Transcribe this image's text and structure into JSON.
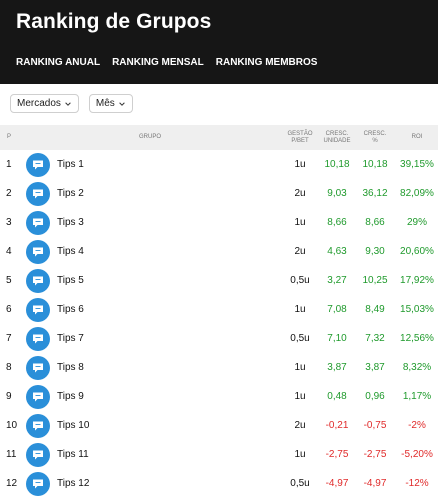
{
  "header": {
    "title": "Ranking de Grupos",
    "nav": [
      "RANKING ANUAL",
      "RANKING MENSAL",
      "RANKING MEMBROS"
    ]
  },
  "filters": {
    "markets_label": "Mercados",
    "period_label": "Mês"
  },
  "table": {
    "columns": {
      "pos": "P",
      "group": "GRUPO",
      "stake": [
        "GESTÃO",
        "P/BET"
      ],
      "units": [
        "CRESC.",
        "UNIDADE"
      ],
      "pct": [
        "CRESC.",
        "%"
      ],
      "roi": "ROI"
    },
    "rows": [
      {
        "pos": "1",
        "name": "Tips 1",
        "stake": "1u",
        "units": "10,18",
        "pct": "10,18",
        "roi": "39,15%"
      },
      {
        "pos": "2",
        "name": "Tips 2",
        "stake": "2u",
        "units": "9,03",
        "pct": "36,12",
        "roi": "82,09%"
      },
      {
        "pos": "3",
        "name": "Tips 3",
        "stake": "1u",
        "units": "8,66",
        "pct": "8,66",
        "roi": "29%"
      },
      {
        "pos": "4",
        "name": "Tips 4",
        "stake": "2u",
        "units": "4,63",
        "pct": "9,30",
        "roi": "20,60%"
      },
      {
        "pos": "5",
        "name": "Tips 5",
        "stake": "0,5u",
        "units": "3,27",
        "pct": "10,25",
        "roi": "17,92%"
      },
      {
        "pos": "6",
        "name": "Tips 6",
        "stake": "1u",
        "units": "7,08",
        "pct": "8,49",
        "roi": "15,03%"
      },
      {
        "pos": "7",
        "name": "Tips 7",
        "stake": "0,5u",
        "units": "7,10",
        "pct": "7,32",
        "roi": "12,56%"
      },
      {
        "pos": "8",
        "name": "Tips 8",
        "stake": "1u",
        "units": "3,87",
        "pct": "3,87",
        "roi": "8,32%"
      },
      {
        "pos": "9",
        "name": "Tips 9",
        "stake": "1u",
        "units": "0,48",
        "pct": "0,96",
        "roi": "1,17%"
      },
      {
        "pos": "10",
        "name": "Tips 10",
        "stake": "2u",
        "units": "-0,21",
        "pct": "-0,75",
        "roi": "-2%"
      },
      {
        "pos": "11",
        "name": "Tips 11",
        "stake": "1u",
        "units": "-2,75",
        "pct": "-2,75",
        "roi": "-5,20%"
      },
      {
        "pos": "12",
        "name": "Tips 12",
        "stake": "0,5u",
        "units": "-4,97",
        "pct": "-4,97",
        "roi": "-12%"
      }
    ]
  },
  "colors": {
    "header_bg": "#161616",
    "positive": "#1f9a2c",
    "negative": "#e02a2a",
    "avatar": "#2a8fd9"
  },
  "icons": {
    "avatar": "chat-bubble-icon",
    "dropdown": "chevron-down-icon"
  }
}
